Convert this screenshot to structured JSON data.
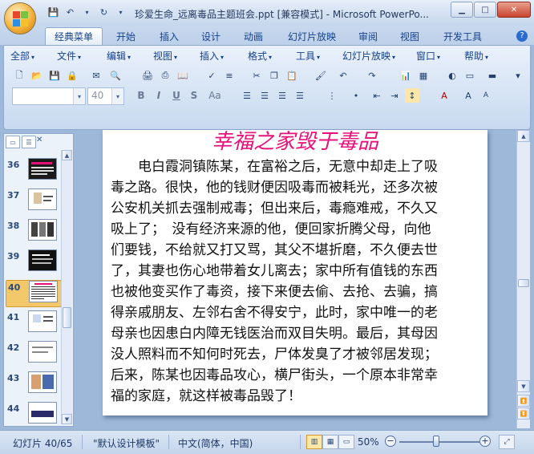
{
  "window": {
    "title": "珍爱生命_远离毒品主题班会.ppt [兼容模式] - Microsoft PowerPo..."
  },
  "ribbon_tabs": [
    "经典菜单",
    "开始",
    "插入",
    "设计",
    "动画",
    "幻灯片放映",
    "审阅",
    "视图",
    "开发工具"
  ],
  "classic_menu": [
    "全部",
    "文件",
    "编辑",
    "视图",
    "插入",
    "格式",
    "工具",
    "幻灯片放映",
    "窗口",
    "帮助"
  ],
  "font": {
    "name": "",
    "size": "40"
  },
  "slide_thumbnails": [
    {
      "num": "36"
    },
    {
      "num": "37"
    },
    {
      "num": "38"
    },
    {
      "num": "39"
    },
    {
      "num": "40"
    },
    {
      "num": "41"
    },
    {
      "num": "42"
    },
    {
      "num": "43"
    },
    {
      "num": "44"
    }
  ],
  "slide": {
    "title": "幸福之家毁于毒品",
    "lines": [
      "　　电白霞洞镇陈某，在富裕之后，无意中却走上了吸",
      "毒之路。很快，他的钱财便因吸毒而被耗光，还多次被",
      "公安机关抓去强制戒毒；但出来后，毒瘾难戒，不久又",
      "吸上了；　没有经济来源的他，便回家折腾父母，向他",
      "们要钱，不给就又打又骂，其父不堪折磨，不久便去世",
      "了，其妻也伤心地带着女儿离去；家中所有值钱的东西",
      "也被他变买作了毒资，接下来便去偷、去抢、去骗，搞",
      "得亲戚朋友、左邻右舍不得安宁，此时，家中唯一的老",
      "母亲也因患白内障无钱医治而双目失明。最后，其母因",
      "没人照料而不知何时死去，尸体发臭了才被邻居发现；",
      "后来，陈某也因毒品攻心，横尸街头，一个原本非常幸",
      "福的家庭，就这样被毒品毁了！"
    ]
  },
  "statusbar": {
    "slide_info": "幻灯片 40/65",
    "template": "\"默认设计模板\"",
    "language": "中文(简体，中国)",
    "zoom": "50%"
  },
  "colors": {
    "title_pink": "#e8107a",
    "selected_thumb": "#f3c86a",
    "frame_blue": "#9eb8d9"
  }
}
